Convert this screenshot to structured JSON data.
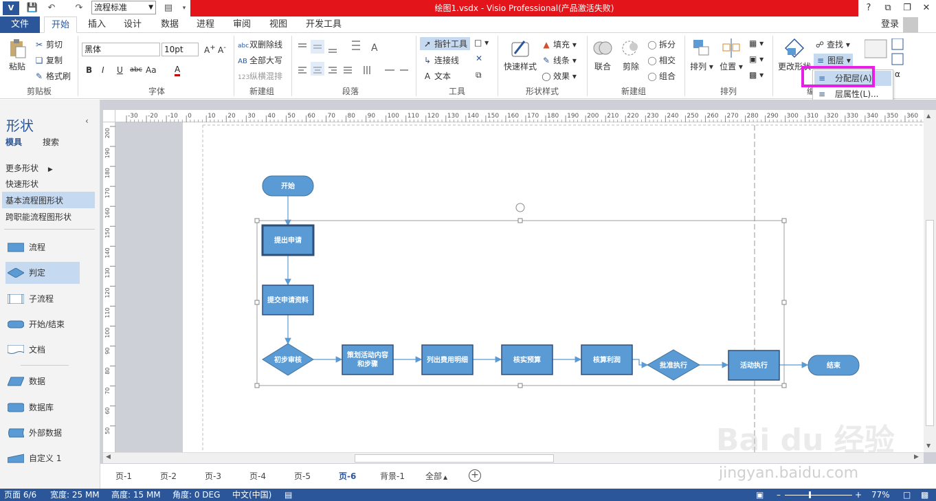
{
  "titlebar": {
    "title": "绘图1.vsdx - Visio Professional(产品激活失败)",
    "style_combo": "流程标准",
    "help": "?",
    "restore_ribbon": "⧉"
  },
  "tabs": [
    "文件",
    "开始",
    "插入",
    "设计",
    "数据",
    "进程",
    "审阅",
    "视图",
    "开发工具"
  ],
  "signin": "登录",
  "clipboard": {
    "paste": "粘贴",
    "cut": "剪切",
    "copy": "复制",
    "format_painter": "格式刷",
    "label": "剪贴板"
  },
  "font": {
    "name": "黑体",
    "size": "10pt",
    "bold": "B",
    "italic": "I",
    "underline": "U",
    "strike": "abc",
    "case": "Aa",
    "color": "A",
    "label": "字体"
  },
  "newgroup1": {
    "double_strike": "双删除线",
    "all_caps": "全部大写",
    "vertical_mix": "纵横混排",
    "label": "新建组"
  },
  "paragraph": {
    "label": "段落"
  },
  "tools": {
    "pointer": "指针工具",
    "connector": "连接线",
    "text": "文本",
    "label": "工具"
  },
  "shape_style": {
    "quick_style": "快速样式",
    "fill": "填充",
    "line": "线条",
    "effect": "效果",
    "label": "形状样式"
  },
  "newgroup2": {
    "union": "联合",
    "fragment": "剪除",
    "split": "拆分",
    "intersect": "相交",
    "combine": "组合",
    "label": "新建组"
  },
  "arrange": {
    "arrange": "排列",
    "position": "位置",
    "label": "排列"
  },
  "editing": {
    "change_shape": "更改形状",
    "find": "查找",
    "layers": "图层",
    "label": "编"
  },
  "popup": {
    "assign_layer": "分配层(A)",
    "layer_props": "层属性(L)..."
  },
  "shapes_panel": {
    "title": "形状",
    "tab_stencil": "模具",
    "tab_search": "搜索",
    "more_shapes": "更多形状",
    "quick_shapes": "快速形状",
    "basic_flow": "基本流程图形状",
    "cross_func": "跨职能流程图形状",
    "items": [
      "流程",
      "判定",
      "子流程",
      "开始/结束",
      "文档",
      "数据",
      "数据库",
      "外部数据",
      "自定义 1"
    ]
  },
  "ruler_h": [
    "-30",
    "-20",
    "-10",
    "0",
    "10",
    "20",
    "30",
    "40",
    "50",
    "60",
    "70",
    "80",
    "90",
    "100",
    "110",
    "120",
    "130",
    "140",
    "150",
    "160",
    "170",
    "180",
    "190",
    "200",
    "210",
    "220",
    "230",
    "240",
    "250",
    "260",
    "270",
    "280",
    "290",
    "300",
    "310",
    "320",
    "330",
    "340",
    "350",
    "360"
  ],
  "ruler_v": [
    "200",
    "190",
    "180",
    "170",
    "160",
    "150",
    "140",
    "130",
    "120",
    "110",
    "100",
    "90",
    "80",
    "70",
    "60",
    "50"
  ],
  "flowchart": {
    "start": "开始",
    "step1": "提出申请",
    "step2": "提交申请资料",
    "decision1": "初步审核",
    "step3a": "策划活动内容",
    "step3b": "和步骤",
    "step4": "列出费用明细",
    "step5": "核实预算",
    "step6": "核算利润",
    "decision2": "批准执行",
    "step7": "活动执行",
    "end": "结束"
  },
  "page_tabs": [
    "页-1",
    "页-2",
    "页-3",
    "页-4",
    "页-5",
    "页-6",
    "背景-1",
    "全部"
  ],
  "status": {
    "page": "页面 6/6",
    "width": "宽度: 25 MM",
    "height": "高度: 15 MM",
    "angle": "角度: 0 DEG",
    "lang": "中文(中国)",
    "zoom": "77%"
  },
  "watermark": {
    "brand": "Bai du 经验",
    "url": "jingyan.baidu.com"
  },
  "colors": {
    "accent": "#2b579a",
    "title_red": "#e3151a",
    "shape_fill": "#5b9bd5",
    "highlight": "#e61ee6"
  }
}
